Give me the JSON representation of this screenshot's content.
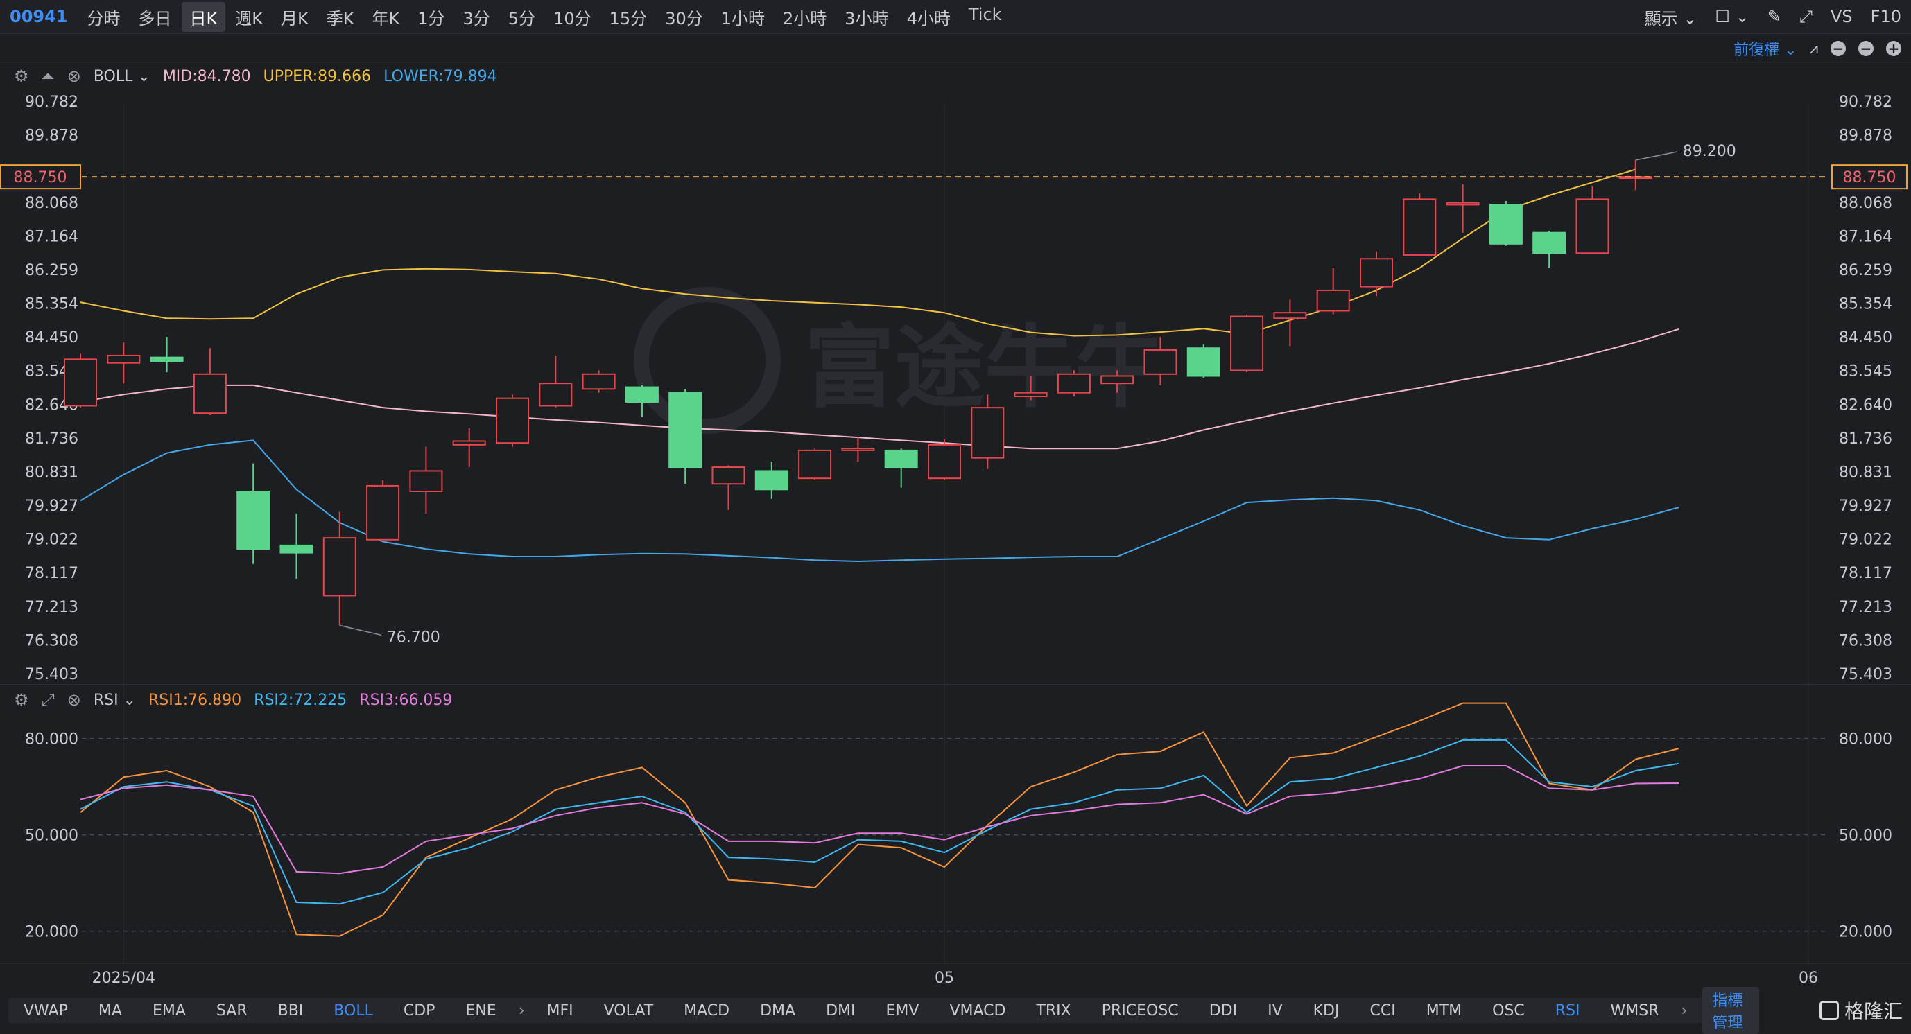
{
  "topbar": {
    "code": "00941",
    "periods": [
      "分時",
      "多日",
      "日K",
      "週K",
      "月K",
      "季K",
      "年K",
      "1分",
      "3分",
      "5分",
      "10分",
      "15分",
      "30分",
      "1小時",
      "2小時",
      "3小時",
      "4小時",
      "Tick"
    ],
    "active_period": "日K",
    "display_label": "顯示",
    "vs_label": "VS",
    "f10_label": "F10"
  },
  "toolbar2": {
    "adjust_label": "前復權"
  },
  "boll_legend": {
    "name": "BOLL",
    "mid": "MID:84.780",
    "upper": "UPPER:89.666",
    "lower": "LOWER:79.894"
  },
  "rsi_legend": {
    "name": "RSI",
    "rsi1": "RSI1:76.890",
    "rsi2": "RSI2:72.225",
    "rsi3": "RSI3:66.059"
  },
  "bottombar": {
    "main_indicators": [
      "VWAP",
      "MA",
      "EMA",
      "SAR",
      "BBI",
      "BOLL",
      "CDP",
      "ENE"
    ],
    "sub_indicators": [
      "MFI",
      "VOLAT",
      "MACD",
      "DMA",
      "DMI",
      "EMV",
      "VMACD",
      "TRIX",
      "PRICEOSC",
      "DDI",
      "IV",
      "KDJ",
      "CCI",
      "MTM",
      "OSC",
      "RSI",
      "WMSR"
    ],
    "active_main": "BOLL",
    "active_sub": "RSI",
    "manage_label": "指標管理"
  },
  "brand": {
    "name": "格隆汇"
  },
  "watermark": "富途牛牛",
  "colors": {
    "up": "#e4464b",
    "down": "#5ad48a",
    "mid": "#f4b8c8",
    "upper": "#f2c343",
    "lower": "#43a7e8",
    "rsi1": "#f7943b",
    "rsi2": "#3fb8ef",
    "rsi3": "#e27bdc",
    "accent": "#3e8ef7"
  },
  "chart_data": [
    {
      "type": "candlestick",
      "indicator": "BOLL",
      "y_ticks": [
        "90.782",
        "89.878",
        "88.068",
        "87.164",
        "86.259",
        "85.354",
        "84.450",
        "83.545",
        "82.640",
        "81.736",
        "80.831",
        "79.927",
        "79.022",
        "78.117",
        "77.213",
        "76.308",
        "75.403"
      ],
      "ylim": [
        75.403,
        90.782
      ],
      "x_labels": [
        "2025/04",
        "05",
        "06"
      ],
      "x_label_index": [
        1,
        20,
        40
      ],
      "last_price": "88.750",
      "max_marker": "89.200",
      "min_marker": "76.700",
      "candles": [
        {
          "o": 82.6,
          "c": 83.85,
          "h": 84.0,
          "l": 82.55
        },
        {
          "o": 83.75,
          "c": 83.95,
          "h": 84.3,
          "l": 83.2
        },
        {
          "o": 83.9,
          "c": 83.8,
          "h": 84.45,
          "l": 83.5
        },
        {
          "o": 82.4,
          "c": 83.45,
          "h": 84.15,
          "l": 82.35
        },
        {
          "o": 80.3,
          "c": 78.75,
          "h": 81.05,
          "l": 78.35
        },
        {
          "o": 78.85,
          "c": 78.65,
          "h": 79.7,
          "l": 77.95
        },
        {
          "o": 77.5,
          "c": 79.05,
          "h": 79.75,
          "l": 76.7
        },
        {
          "o": 79.0,
          "c": 80.45,
          "h": 80.6,
          "l": 79.0
        },
        {
          "o": 80.3,
          "c": 80.85,
          "h": 81.5,
          "l": 79.7
        },
        {
          "o": 81.55,
          "c": 81.65,
          "h": 82.0,
          "l": 80.95
        },
        {
          "o": 81.6,
          "c": 82.8,
          "h": 82.9,
          "l": 81.5
        },
        {
          "o": 82.6,
          "c": 83.2,
          "h": 83.95,
          "l": 82.55
        },
        {
          "o": 83.05,
          "c": 83.45,
          "h": 83.55,
          "l": 82.95
        },
        {
          "o": 83.1,
          "c": 82.7,
          "h": 83.15,
          "l": 82.3
        },
        {
          "o": 82.95,
          "c": 80.95,
          "h": 83.05,
          "l": 80.5
        },
        {
          "o": 80.5,
          "c": 80.95,
          "h": 81.0,
          "l": 79.8
        },
        {
          "o": 80.85,
          "c": 80.35,
          "h": 81.1,
          "l": 80.1
        },
        {
          "o": 80.65,
          "c": 81.4,
          "h": 81.45,
          "l": 80.6
        },
        {
          "o": 81.4,
          "c": 81.45,
          "h": 81.75,
          "l": 81.1
        },
        {
          "o": 81.4,
          "c": 80.95,
          "h": 81.45,
          "l": 80.4
        },
        {
          "o": 80.65,
          "c": 81.55,
          "h": 81.7,
          "l": 80.6
        },
        {
          "o": 81.2,
          "c": 82.55,
          "h": 82.9,
          "l": 80.9
        },
        {
          "o": 82.85,
          "c": 82.95,
          "h": 83.4,
          "l": 82.75
        },
        {
          "o": 82.95,
          "c": 83.45,
          "h": 83.55,
          "l": 82.85
        },
        {
          "o": 83.2,
          "c": 83.4,
          "h": 83.55,
          "l": 82.95
        },
        {
          "o": 83.45,
          "c": 84.1,
          "h": 84.45,
          "l": 83.15
        },
        {
          "o": 84.15,
          "c": 83.4,
          "h": 84.25,
          "l": 83.35
        },
        {
          "o": 83.55,
          "c": 85.0,
          "h": 85.05,
          "l": 83.5
        },
        {
          "o": 84.95,
          "c": 85.1,
          "h": 85.45,
          "l": 84.2
        },
        {
          "o": 85.15,
          "c": 85.7,
          "h": 86.3,
          "l": 85.05
        },
        {
          "o": 85.8,
          "c": 86.55,
          "h": 86.75,
          "l": 85.55
        },
        {
          "o": 86.65,
          "c": 88.15,
          "h": 88.3,
          "l": 86.65
        },
        {
          "o": 88.0,
          "c": 88.05,
          "h": 88.55,
          "l": 87.25
        },
        {
          "o": 88.0,
          "c": 86.95,
          "h": 88.1,
          "l": 86.9
        },
        {
          "o": 87.25,
          "c": 86.7,
          "h": 87.3,
          "l": 86.3
        },
        {
          "o": 86.7,
          "c": 88.15,
          "h": 88.5,
          "l": 86.7
        },
        {
          "o": 88.75,
          "c": 88.75,
          "h": 89.2,
          "l": 88.4
        }
      ],
      "series": [
        {
          "name": "UPPER",
          "values": [
            85.38,
            85.15,
            84.95,
            84.93,
            84.95,
            85.6,
            86.05,
            86.25,
            86.28,
            86.26,
            86.2,
            86.15,
            86.0,
            85.75,
            85.6,
            85.5,
            85.42,
            85.37,
            85.32,
            85.25,
            85.1,
            84.8,
            84.57,
            84.48,
            84.5,
            84.58,
            84.67,
            84.53,
            84.9,
            85.25,
            85.7,
            86.3,
            87.1,
            87.85,
            88.25,
            88.6,
            88.95
          ]
        },
        {
          "name": "MID",
          "values": [
            82.7,
            82.9,
            83.05,
            83.15,
            83.15,
            82.95,
            82.75,
            82.55,
            82.45,
            82.38,
            82.3,
            82.22,
            82.15,
            82.07,
            82.0,
            81.95,
            81.9,
            81.82,
            81.75,
            81.67,
            81.6,
            81.52,
            81.45,
            81.45,
            81.45,
            81.65,
            81.95,
            82.2,
            82.45,
            82.67,
            82.88,
            83.08,
            83.3,
            83.5,
            83.73,
            84.0,
            84.3,
            84.66
          ]
        },
        {
          "name": "LOWER",
          "values": [
            80.05,
            80.75,
            81.33,
            81.55,
            81.67,
            80.35,
            79.46,
            78.95,
            78.75,
            78.62,
            78.55,
            78.55,
            78.6,
            78.63,
            78.62,
            78.57,
            78.52,
            78.45,
            78.42,
            78.45,
            78.48,
            78.5,
            78.53,
            78.55,
            78.55,
            79.02,
            79.5,
            80.0,
            80.07,
            80.12,
            80.05,
            79.8,
            79.38,
            79.05,
            79.0,
            79.3,
            79.55,
            79.87
          ]
        }
      ]
    },
    {
      "type": "line",
      "indicator": "RSI",
      "y_ticks": [
        "80.000",
        "50.000",
        "20.000"
      ],
      "ylim": [
        10,
        92
      ],
      "series": [
        {
          "name": "RSI1",
          "values": [
            57.0,
            68.0,
            70.0,
            65.0,
            57.0,
            19.0,
            18.5,
            25.0,
            43.0,
            49.0,
            55.0,
            64.0,
            68.0,
            71.0,
            60.0,
            36.0,
            35.0,
            33.5,
            47.0,
            46.0,
            40.0,
            53.0,
            65.0,
            69.5,
            75.0,
            76.0,
            82.0,
            59.0,
            74.0,
            75.5,
            80.5,
            85.5,
            91.0,
            91.0,
            66.0,
            64.0,
            73.5,
            76.9
          ]
        },
        {
          "name": "RSI2",
          "values": [
            58.0,
            65.0,
            66.5,
            64.0,
            59.0,
            29.0,
            28.5,
            32.0,
            42.5,
            46.0,
            51.0,
            58.0,
            60.0,
            62.0,
            57.0,
            43.0,
            42.5,
            41.5,
            48.5,
            48.0,
            44.5,
            51.5,
            58.0,
            60.0,
            64.0,
            64.5,
            68.5,
            57.0,
            66.5,
            67.5,
            71.0,
            74.5,
            79.5,
            79.5,
            66.5,
            65.0,
            70.0,
            72.2
          ]
        },
        {
          "name": "RSI3",
          "values": [
            61.0,
            64.5,
            65.5,
            64.0,
            62.0,
            38.5,
            38.0,
            40.0,
            48.0,
            50.0,
            52.0,
            56.0,
            58.5,
            60.0,
            56.5,
            48.0,
            48.0,
            47.5,
            50.5,
            50.5,
            48.5,
            52.5,
            56.0,
            57.5,
            59.5,
            60.0,
            62.5,
            56.5,
            62.0,
            63.0,
            65.0,
            67.5,
            71.5,
            71.5,
            64.5,
            64.0,
            66.0,
            66.1
          ]
        }
      ]
    }
  ]
}
